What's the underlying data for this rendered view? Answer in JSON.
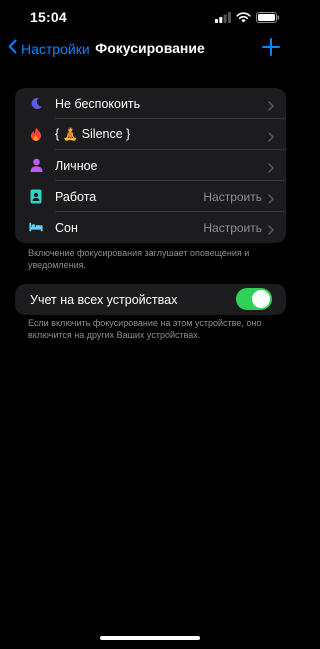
{
  "status": {
    "time": "15:04"
  },
  "nav": {
    "back_label": "Настройки",
    "title": "Фокусирование"
  },
  "focus_modes": [
    {
      "label": "Не беспокоить",
      "detail": "",
      "icon": "moon-icon",
      "color": "#5e5ce6"
    },
    {
      "label": "{ 🧘 Silence }",
      "detail": "",
      "icon": "flame-icon",
      "color": "#ff453a"
    },
    {
      "label": "Личное",
      "detail": "",
      "icon": "person-icon",
      "color": "#bf5af2"
    },
    {
      "label": "Работа",
      "detail": "Настроить",
      "icon": "badge-icon",
      "color": "#30d5c8"
    },
    {
      "label": "Сон",
      "detail": "Настроить",
      "icon": "bed-icon",
      "color": "#64d2ff"
    }
  ],
  "focus_footnote": "Включение фокусирования заглушает оповещения и уведомления.",
  "share_setting": {
    "label": "Учет на всех устройствах",
    "enabled": true
  },
  "share_footnote": "Если включить фокусирование на этом устройстве, оно включится на других Ваших устройствах.",
  "colors": {
    "accent": "#0a84ff",
    "toggle_on": "#30d158"
  }
}
